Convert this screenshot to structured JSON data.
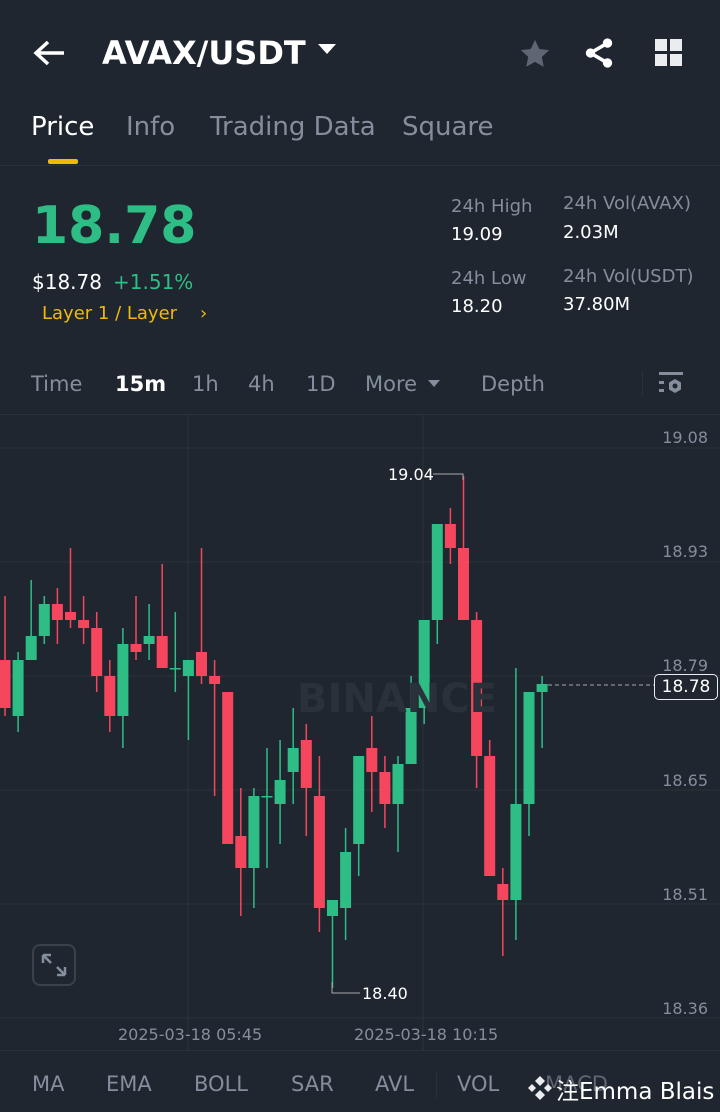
{
  "header": {
    "title": "AVAX/USDT",
    "icons": [
      "back-arrow-icon",
      "chevron-down-icon",
      "star-icon",
      "share-icon",
      "grid-icon"
    ]
  },
  "tabs": [
    "Price",
    "Info",
    "Trading Data",
    "Square"
  ],
  "ticker": {
    "last": "18.78",
    "usd": "$18.78",
    "change": "+1.51%",
    "tag": "Layer 1 / Layer",
    "tag_chevron": "›",
    "stats": [
      {
        "label": "24h High",
        "value": "19.09"
      },
      {
        "label": "24h Vol(AVAX)",
        "value": "2.03M"
      },
      {
        "label": "24h Low",
        "value": "18.20"
      },
      {
        "label": "24h Vol(USDT)",
        "value": "37.80M"
      }
    ]
  },
  "timeframes": [
    "Time",
    "15m",
    "1h",
    "4h",
    "1D",
    "More",
    "Depth"
  ],
  "indicators": [
    "MA",
    "EMA",
    "BOLL",
    "SAR",
    "AVL",
    "VOL",
    "MACD"
  ],
  "watermark": "BINANCE",
  "overlay_text": "注Emma Blais",
  "colors": {
    "up": "#2ebd85",
    "down": "#f6465d",
    "accent": "#f0b90b",
    "bg": "#1f2630"
  },
  "chart_data": {
    "type": "candlestick",
    "y_ticks": [
      "19.08",
      "18.93",
      "18.79",
      "18.65",
      "18.51",
      "18.36"
    ],
    "x_ticks": [
      "2025-03-18 05:45",
      "2025-03-18 10:15"
    ],
    "high_label": "19.04",
    "low_label": "18.40",
    "last_price": "18.78",
    "ylim": [
      18.35,
      19.12
    ],
    "candles": [
      [
        18.81,
        18.89,
        18.74,
        18.75
      ],
      [
        18.74,
        18.82,
        18.72,
        18.81
      ],
      [
        18.81,
        18.91,
        18.81,
        18.84
      ],
      [
        18.84,
        18.89,
        18.83,
        18.88
      ],
      [
        18.88,
        18.9,
        18.83,
        18.86
      ],
      [
        18.87,
        18.95,
        18.85,
        18.86
      ],
      [
        18.86,
        18.89,
        18.83,
        18.85
      ],
      [
        18.85,
        18.87,
        18.77,
        18.79
      ],
      [
        18.79,
        18.81,
        18.72,
        18.74
      ],
      [
        18.74,
        18.85,
        18.7,
        18.83
      ],
      [
        18.83,
        18.89,
        18.81,
        18.82
      ],
      [
        18.83,
        18.88,
        18.81,
        18.84
      ],
      [
        18.84,
        18.93,
        18.8,
        18.8
      ],
      [
        18.8,
        18.87,
        18.77,
        18.8
      ],
      [
        18.79,
        18.81,
        18.71,
        18.81
      ],
      [
        18.82,
        18.95,
        18.78,
        18.79
      ],
      [
        18.79,
        18.81,
        18.64,
        18.78
      ],
      [
        18.77,
        18.77,
        18.58,
        18.58
      ],
      [
        18.59,
        18.65,
        18.49,
        18.55
      ],
      [
        18.55,
        18.65,
        18.5,
        18.64
      ],
      [
        18.64,
        18.7,
        18.55,
        18.64
      ],
      [
        18.63,
        18.71,
        18.58,
        18.66
      ],
      [
        18.67,
        18.75,
        18.63,
        18.7
      ],
      [
        18.71,
        18.73,
        18.59,
        18.65
      ],
      [
        18.64,
        18.69,
        18.47,
        18.5
      ],
      [
        18.49,
        18.51,
        18.4,
        18.51
      ],
      [
        18.5,
        18.6,
        18.46,
        18.57
      ],
      [
        18.58,
        18.69,
        18.54,
        18.69
      ],
      [
        18.7,
        18.74,
        18.62,
        18.67
      ],
      [
        18.67,
        18.69,
        18.6,
        18.63
      ],
      [
        18.63,
        18.69,
        18.57,
        18.68
      ],
      [
        18.68,
        18.79,
        18.68,
        18.75
      ],
      [
        18.75,
        18.86,
        18.73,
        18.86
      ],
      [
        18.86,
        18.98,
        18.83,
        18.98
      ],
      [
        18.98,
        19.0,
        18.93,
        18.95
      ],
      [
        18.95,
        19.04,
        18.86,
        18.86
      ],
      [
        18.86,
        18.87,
        18.65,
        18.69
      ],
      [
        18.69,
        18.71,
        18.54,
        18.54
      ],
      [
        18.53,
        18.55,
        18.44,
        18.51
      ],
      [
        18.51,
        18.8,
        18.46,
        18.63
      ],
      [
        18.63,
        18.77,
        18.59,
        18.77
      ],
      [
        18.77,
        18.79,
        18.7,
        18.78
      ]
    ]
  }
}
